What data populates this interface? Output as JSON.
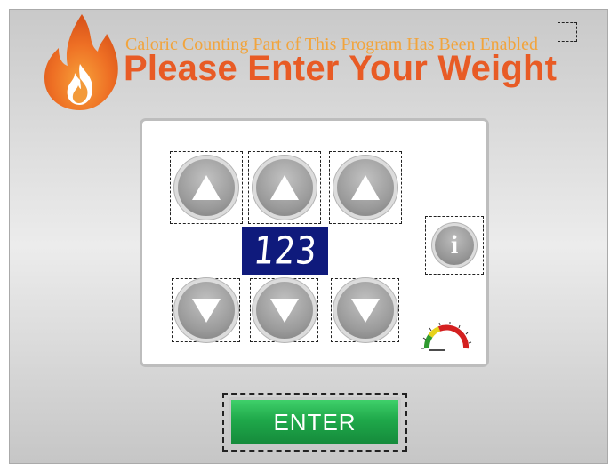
{
  "header": {
    "subtitle": "Caloric Counting Part of This Program Has Been Enabled",
    "title": "Please Enter Your Weight"
  },
  "weight_entry": {
    "display_value": "123",
    "up_buttons": [
      "hundreds-up",
      "tens-up",
      "ones-up"
    ],
    "down_buttons": [
      "hundreds-down",
      "tens-down",
      "ones-down"
    ]
  },
  "actions": {
    "enter_label": "ENTER",
    "info_label": "i"
  },
  "icons": {
    "logo": "flame-icon",
    "gauge": "gauge-icon"
  },
  "colors": {
    "title": "#e85b25",
    "subtitle": "#f2a43c",
    "display_bg": "#0f1a7c",
    "enter_button": "#1fa84a"
  }
}
